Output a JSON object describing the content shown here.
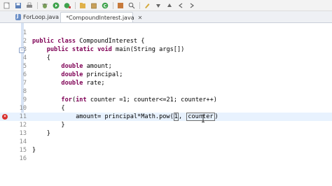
{
  "toolbar": {
    "icons": [
      "new-icon",
      "save-icon",
      "print-icon",
      "debug-icon",
      "run-icon",
      "new-java-project-icon",
      "new-package-icon",
      "new-class-icon",
      "search-icon",
      "next-annotation-icon",
      "prev-annotation-icon",
      "back-icon",
      "forward-icon"
    ]
  },
  "tabs": [
    {
      "label": "ForLoop.java",
      "active": false
    },
    {
      "label": "*CompoundInterest.java",
      "active": true,
      "close": "✕"
    }
  ],
  "editor": {
    "lines": [
      {
        "n": "1",
        "text": ""
      },
      {
        "n": "2",
        "tokens": [
          {
            "k": "kw",
            "t": "public class"
          },
          {
            "t": " CompoundInterest {"
          }
        ]
      },
      {
        "n": "3",
        "fold": "−",
        "tokens": [
          {
            "t": "    "
          },
          {
            "k": "kw",
            "t": "public static void"
          },
          {
            "t": " main(String args[])"
          }
        ]
      },
      {
        "n": "4",
        "tokens": [
          {
            "t": "    {"
          }
        ]
      },
      {
        "n": "5",
        "tokens": [
          {
            "t": "        "
          },
          {
            "k": "kw",
            "t": "double"
          },
          {
            "t": " amount;"
          }
        ]
      },
      {
        "n": "6",
        "tokens": [
          {
            "t": "        "
          },
          {
            "k": "kw",
            "t": "double"
          },
          {
            "t": " principal;"
          }
        ]
      },
      {
        "n": "7",
        "tokens": [
          {
            "t": "        "
          },
          {
            "k": "kw",
            "t": "double"
          },
          {
            "t": " rate;"
          }
        ]
      },
      {
        "n": "8",
        "text": ""
      },
      {
        "n": "9",
        "tokens": [
          {
            "t": "        "
          },
          {
            "k": "kw",
            "t": "for"
          },
          {
            "t": "("
          },
          {
            "k": "kw",
            "t": "int"
          },
          {
            "t": " counter =1; counter<=21; counter++)"
          }
        ]
      },
      {
        "n": "10",
        "tokens": [
          {
            "t": "        {"
          }
        ]
      },
      {
        "n": "11",
        "error": true,
        "current": true,
        "tokens": [
          {
            "t": "            amount= principal*Math.pow("
          },
          {
            "k": "box1",
            "t": "1"
          },
          {
            "t": ", "
          },
          {
            "k": "box2",
            "t": "counter"
          },
          {
            "t": ")"
          }
        ]
      },
      {
        "n": "12",
        "tokens": [
          {
            "t": "        }"
          }
        ]
      },
      {
        "n": "13",
        "tokens": [
          {
            "t": "    }"
          }
        ]
      },
      {
        "n": "14",
        "text": ""
      },
      {
        "n": "15",
        "tokens": [
          {
            "t": "}"
          }
        ]
      },
      {
        "n": "16",
        "text": ""
      }
    ]
  },
  "colors": {
    "keyword": "#7f0055",
    "error": "#d9302c",
    "current_line": "#e8f2fe"
  }
}
